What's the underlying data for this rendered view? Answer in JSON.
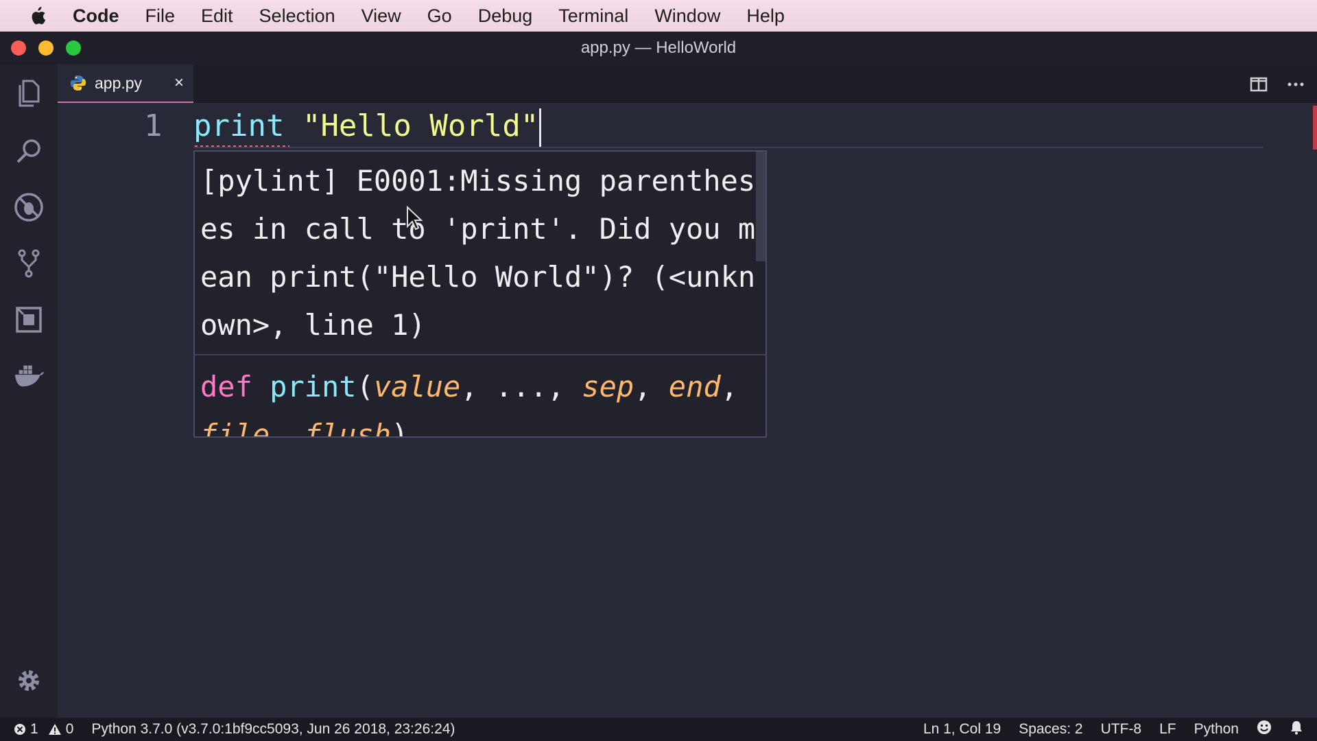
{
  "menubar": {
    "app": "Code",
    "items": [
      "File",
      "Edit",
      "Selection",
      "View",
      "Go",
      "Debug",
      "Terminal",
      "Window",
      "Help"
    ]
  },
  "window": {
    "title": "app.py — HelloWorld"
  },
  "tab": {
    "label": "app.py",
    "close": "×"
  },
  "editor": {
    "line_number": "1",
    "keyword": "print",
    "string": "\"Hello World\""
  },
  "hover": {
    "message": "[pylint] E0001:Missing parentheses in call to 'print'. Did you mean print(\"Hello World\")? (<unknown>, line 1)",
    "signature": {
      "def": "def",
      "fn": "print",
      "open": "(",
      "p1": "value",
      "sep1": ", ..., ",
      "p2": "sep",
      "sep2": ", ",
      "p3": "end",
      "sep3": ", ",
      "p4": "file",
      "sep4": ", ",
      "p5": "flush",
      "close": ")"
    }
  },
  "statusbar": {
    "errors": "1",
    "warnings": "0",
    "interpreter": "Python 3.7.0 (v3.7.0:1bf9cc5093, Jun 26 2018, 23:26:24)",
    "position": "Ln 1, Col 19",
    "spaces": "Spaces: 2",
    "encoding": "UTF-8",
    "eol": "LF",
    "language": "Python"
  },
  "colors": {
    "accent": "#d46ea6",
    "keyword": "#8be9fd",
    "string": "#f1fa8c",
    "def": "#ff79c6",
    "param": "#ffb86c"
  },
  "icons": {
    "activity": [
      "files-icon",
      "search-icon",
      "debug-icon",
      "source-control-icon",
      "extensions-icon",
      "docker-icon",
      "gear-icon"
    ],
    "tab": "python-file-icon",
    "editor_actions": [
      "split-editor-icon",
      "more-actions-icon"
    ],
    "status": [
      "error-icon",
      "warning-icon",
      "smiley-feedback-icon",
      "bell-icon"
    ]
  }
}
